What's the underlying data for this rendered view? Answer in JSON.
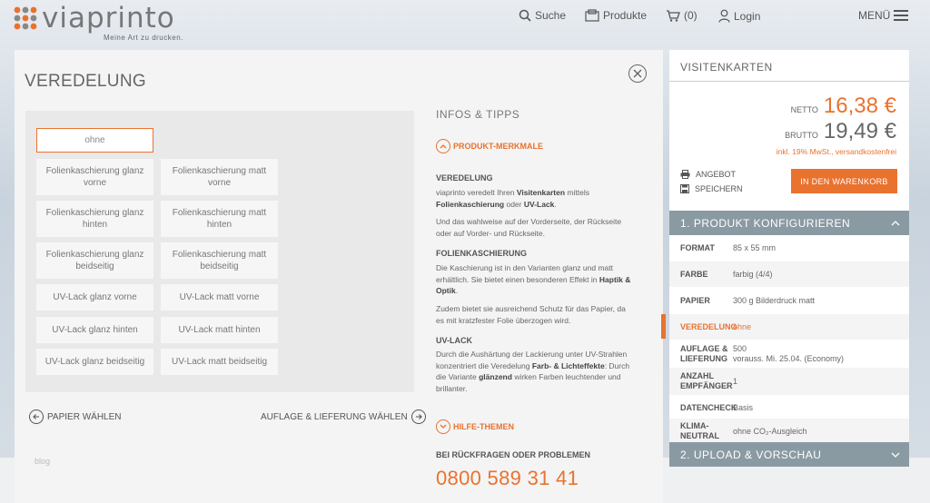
{
  "header": {
    "logo_text": "viaprinto",
    "tagline": "Meine Art zu drucken.",
    "nav": {
      "search": "Suche",
      "products": "Produkte",
      "cart": "(0)",
      "login": "Login",
      "menu": "MENÜ"
    }
  },
  "panel": {
    "title": "VEREDELUNG",
    "options": [
      "ohne",
      "Folienkaschierung glanz vorne",
      "Folienkaschierung matt vorne",
      "Folienkaschierung glanz hinten",
      "Folienkaschierung matt hinten",
      "Folienkaschierung glanz beidseitig",
      "Folienkaschierung matt beidseitig",
      "UV-Lack glanz vorne",
      "UV-Lack matt vorne",
      "UV-Lack glanz hinten",
      "UV-Lack matt hinten",
      "UV-Lack glanz beidseitig",
      "UV-Lack matt beidseitig"
    ],
    "selected_option": "ohne",
    "back_link": "PAPIER WÄHLEN",
    "next_link": "AUFLAGE & LIEFERUNG WÄHLEN",
    "blog": "blog"
  },
  "info": {
    "heading": "INFOS & TIPPS",
    "features_toggle": "PRODUKT-MERKMALE",
    "veredelung_title": "VEREDELUNG",
    "veredelung_p1_a": "viaprinto veredelt Ihren ",
    "veredelung_p1_b": "Visitenkarten",
    "veredelung_p1_c": " mittels ",
    "veredelung_p1_d": "Folienkaschierung",
    "veredelung_p1_e": " oder ",
    "veredelung_p1_f": "UV-Lack",
    "veredelung_p1_g": ".",
    "veredelung_p2": "Und das wahlweise auf der Vorderseite, der Rückseite oder auf Vorder- und Rückseite.",
    "folie_title": "FOLIENKASCHIERUNG",
    "folie_p1_a": "Die Kaschierung ist in den Varianten glanz und matt erhältlich. Sie bietet einen besonderen Effekt in ",
    "folie_p1_b": "Haptik & Optik",
    "folie_p1_c": ".",
    "folie_p2": "Zudem bietet sie ausreichend Schutz für das Papier, da es mit kratzfester Folie überzogen wird.",
    "uv_title": "UV-LACK",
    "uv_p1_a": "Durch die Aushärtung der Lackierung unter UV-Strahlen konzentriert die Veredelung ",
    "uv_p1_b": "Farb- & Lichteffekte",
    "uv_p1_c": ": Durch die Variante ",
    "uv_p1_d": "glänzend",
    "uv_p1_e": " wirken Farben leuchtender und brillanter.",
    "help_toggle": "HILFE-THEMEN",
    "contact_title": "BEI RÜCKFRAGEN ODER PROBLEMEN",
    "phone": "0800 589 31 41"
  },
  "sidebar": {
    "title": "VISITENKARTEN",
    "netto_label": "NETTO",
    "netto_value": "16,38 €",
    "brutto_label": "BRUTTO",
    "brutto_value": "19,49 €",
    "vat_note": "inkl. 19% MwSt., versandkostenfrei",
    "offer": "ANGEBOT",
    "save": "SPEICHERN",
    "cart_button": "IN DEN WARENKORB",
    "section1": "1. PRODUKT KONFIGURIEREN",
    "section2": "2. UPLOAD & VORSCHAU",
    "rows": [
      {
        "label": "FORMAT",
        "value": "85 x 55 mm"
      },
      {
        "label": "FARBE",
        "value": "farbig (4/4)"
      },
      {
        "label": "PAPIER",
        "value": "300 g Bilderdruck matt"
      },
      {
        "label": "VEREDELUNG",
        "value": "ohne"
      },
      {
        "label": "AUFLAGE & LIEFERUNG",
        "value": "500",
        "value2": "vorauss. Mi. 25.04. (Economy)"
      },
      {
        "label": "ANZAHL EMPFÄNGER",
        "value": "1"
      },
      {
        "label": "DATENCHECK",
        "value": "Basis"
      },
      {
        "label": "KLIMA-NEUTRAL",
        "value": "ohne CO₂-Ausgleich"
      }
    ]
  },
  "colors": {
    "accent": "#e9722e",
    "section_head": "#8a9aa2"
  }
}
